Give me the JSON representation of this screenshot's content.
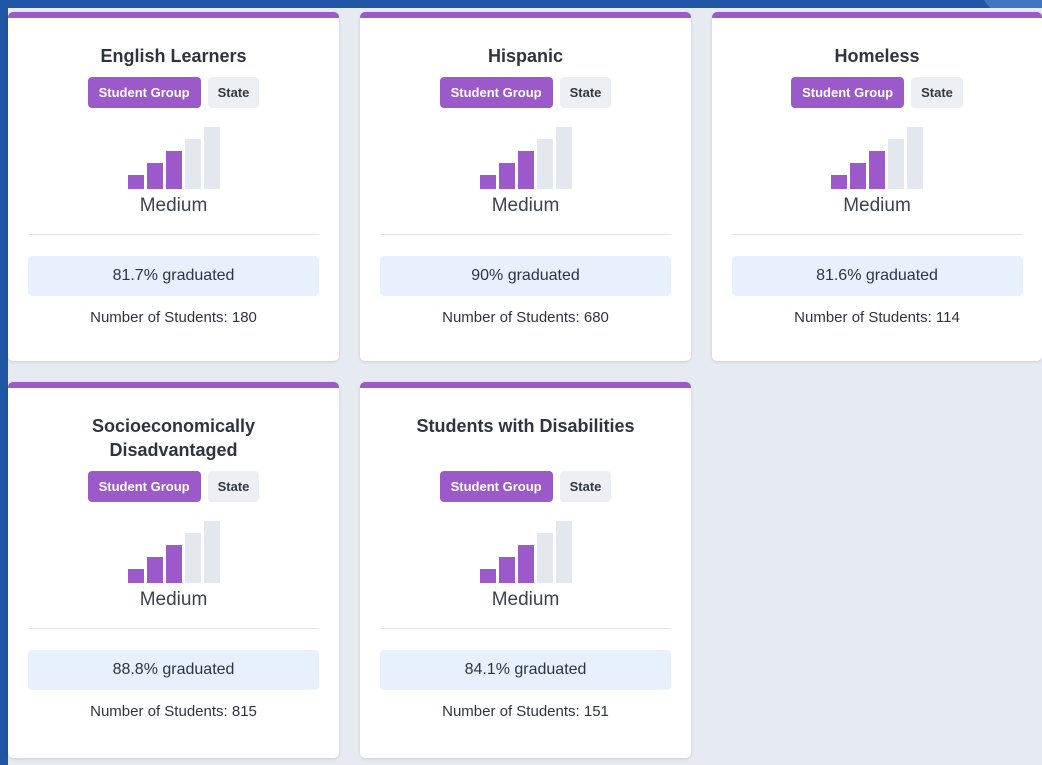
{
  "badge_group": "Student Group",
  "badge_state": "State",
  "cards": [
    {
      "title": "English Learners",
      "level": "Medium",
      "level_bars": 3,
      "level_max": 5,
      "graduated": "81.7% graduated",
      "students": "Number of Students: 180"
    },
    {
      "title": "Hispanic",
      "level": "Medium",
      "level_bars": 3,
      "level_max": 5,
      "graduated": "90% graduated",
      "students": "Number of Students: 680"
    },
    {
      "title": "Homeless",
      "level": "Medium",
      "level_bars": 3,
      "level_max": 5,
      "graduated": "81.6% graduated",
      "students": "Number of Students: 114"
    },
    {
      "title": "Socioeconomically Disadvantaged",
      "level": "Medium",
      "level_bars": 3,
      "level_max": 5,
      "graduated": "88.8% graduated",
      "students": "Number of Students: 815"
    },
    {
      "title": "Students with Disabilities",
      "level": "Medium",
      "level_bars": 3,
      "level_max": 5,
      "graduated": "84.1% graduated",
      "students": "Number of Students: 151"
    }
  ],
  "colors": {
    "accent": "#9b59c9",
    "bar_inactive": "#e3e8ef",
    "graduated_bg": "#e6f1fd",
    "page_bg": "#e6ebf2"
  }
}
